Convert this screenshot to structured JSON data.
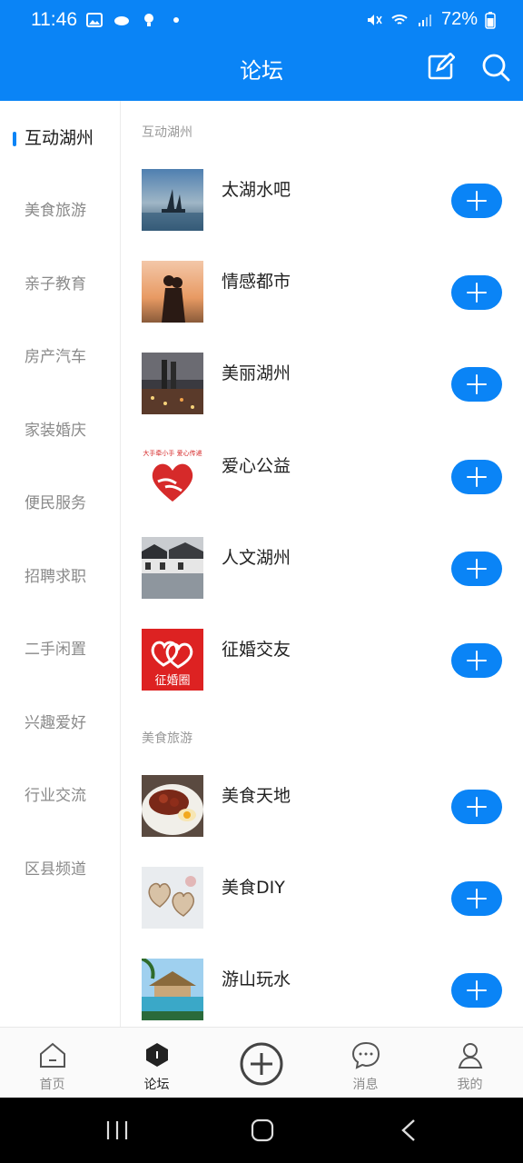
{
  "status": {
    "time": "11:46",
    "battery": "72%"
  },
  "header": {
    "title": "论坛"
  },
  "sidebar": {
    "items": [
      {
        "label": "互动湖州",
        "active": true
      },
      {
        "label": "美食旅游"
      },
      {
        "label": "亲子教育"
      },
      {
        "label": "房产汽车"
      },
      {
        "label": "家装婚庆"
      },
      {
        "label": "便民服务"
      },
      {
        "label": "招聘求职"
      },
      {
        "label": "二手闲置"
      },
      {
        "label": "兴趣爱好"
      },
      {
        "label": "行业交流"
      },
      {
        "label": "区县频道"
      }
    ]
  },
  "sections": [
    {
      "title": "互动湖州",
      "forums": [
        {
          "name": "太湖水吧",
          "thumb": "lake-boats"
        },
        {
          "name": "情感都市",
          "thumb": "couple-sunset"
        },
        {
          "name": "美丽湖州",
          "thumb": "city-night"
        },
        {
          "name": "爱心公益",
          "thumb": "heart-hands",
          "thumb_text": "大手牵小手 爱心传递"
        },
        {
          "name": "人文湖州",
          "thumb": "water-town"
        },
        {
          "name": "征婚交友",
          "thumb": "double-heart",
          "thumb_text": "征婚圈"
        }
      ]
    },
    {
      "title": "美食旅游",
      "forums": [
        {
          "name": "美食天地",
          "thumb": "food-bowl"
        },
        {
          "name": "美食DIY",
          "thumb": "cookies"
        },
        {
          "name": "游山玩水",
          "thumb": "resort-pool"
        }
      ]
    }
  ],
  "tabs": [
    {
      "label": "首页",
      "icon": "home-icon"
    },
    {
      "label": "论坛",
      "icon": "forum-icon",
      "active": true
    },
    {
      "label": "",
      "icon": "add-circle-icon"
    },
    {
      "label": "消息",
      "icon": "message-icon"
    },
    {
      "label": "我的",
      "icon": "profile-icon"
    }
  ],
  "colors": {
    "accent": "#0a84f6"
  }
}
